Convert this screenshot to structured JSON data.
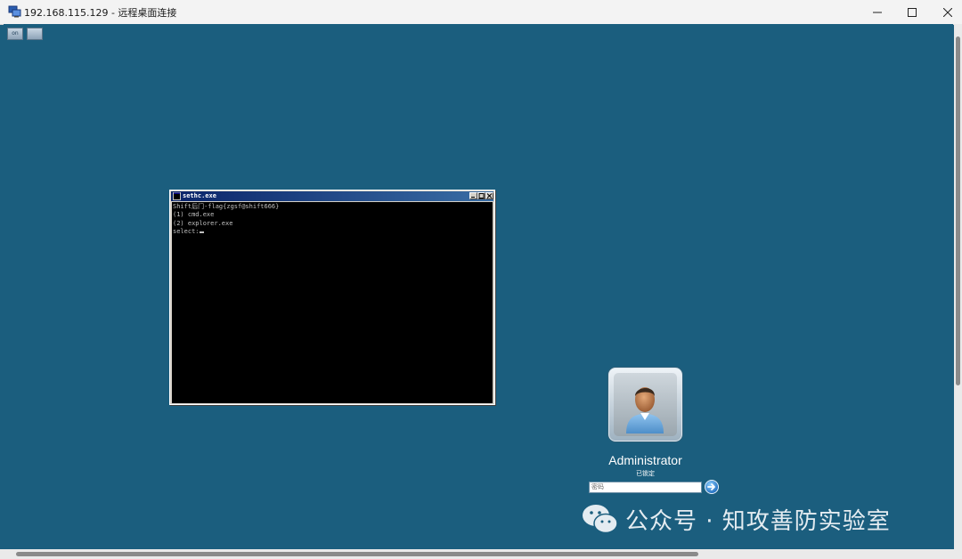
{
  "window": {
    "title": "192.168.115.129 - 远程桌面连接",
    "controls": [
      "minimize",
      "maximize",
      "close"
    ]
  },
  "rdp_toolbar": {
    "left_button_label": "on",
    "right_button_label": ""
  },
  "console": {
    "title": "sethc.exe",
    "lines": [
      "Shift后门-flag{zgsf@shift666}",
      "(1) cmd.exe",
      "(2) explorer.exe",
      "select:"
    ]
  },
  "login": {
    "username": "Administrator",
    "status": "已锁定",
    "password_placeholder": "密码"
  },
  "watermark": {
    "text": "公众号 · 知攻善防实验室"
  },
  "colors": {
    "desktop_bg": "#1b5e7e",
    "titlebar_bg": "#f3f3f3",
    "console_bg": "#000000",
    "console_text": "#c0c0c0"
  }
}
